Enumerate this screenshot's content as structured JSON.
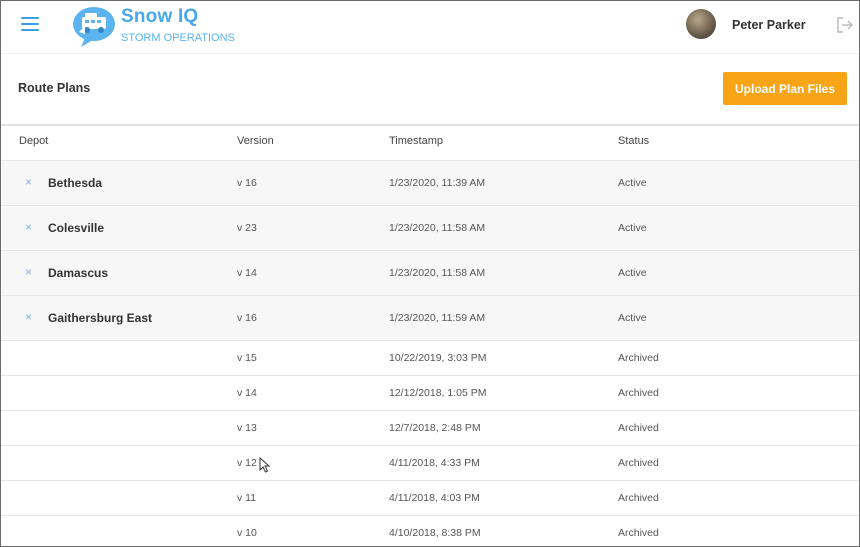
{
  "app": {
    "name": "Snow IQ",
    "subtitle": "STORM OPERATIONS",
    "user": "Peter Parker",
    "colors": {
      "brand": "#46a9ee",
      "accent": "#f7a416"
    }
  },
  "icons": {
    "menu": "hamburger-menu-icon",
    "logo": "snow-plow-logo-icon",
    "logout": "logout-icon",
    "remove": "close-icon"
  },
  "page": {
    "title": "Route Plans",
    "upload_label": "Upload Plan Files"
  },
  "table": {
    "headers": {
      "depot": "Depot",
      "version": "Version",
      "timestamp": "Timestamp",
      "status": "Status"
    },
    "active_rows": [
      {
        "remove": "×",
        "depot": "Bethesda",
        "version": "v 16",
        "timestamp": "1/23/2020, 11:39 AM",
        "status": "Active"
      },
      {
        "remove": "×",
        "depot": "Colesville",
        "version": "v 23",
        "timestamp": "1/23/2020, 11:58 AM",
        "status": "Active"
      },
      {
        "remove": "×",
        "depot": "Damascus",
        "version": "v 14",
        "timestamp": "1/23/2020, 11:58 AM",
        "status": "Active"
      },
      {
        "remove": "×",
        "depot": "Gaithersburg East",
        "version": "v 16",
        "timestamp": "1/23/2020, 11:59 AM",
        "status": "Active"
      }
    ],
    "archived_rows": [
      {
        "version": "v 15",
        "timestamp": "10/22/2019, 3:03 PM",
        "status": "Archived"
      },
      {
        "version": "v 14",
        "timestamp": "12/12/2018, 1:05 PM",
        "status": "Archived"
      },
      {
        "version": "v 13",
        "timestamp": "12/7/2018, 2:48 PM",
        "status": "Archived"
      },
      {
        "version": "v 12",
        "timestamp": "4/11/2018, 4:33 PM",
        "status": "Archived"
      },
      {
        "version": "v 11",
        "timestamp": "4/11/2018, 4:03 PM",
        "status": "Archived"
      },
      {
        "version": "v 10",
        "timestamp": "4/10/2018, 8:38 PM",
        "status": "Archived"
      }
    ]
  }
}
